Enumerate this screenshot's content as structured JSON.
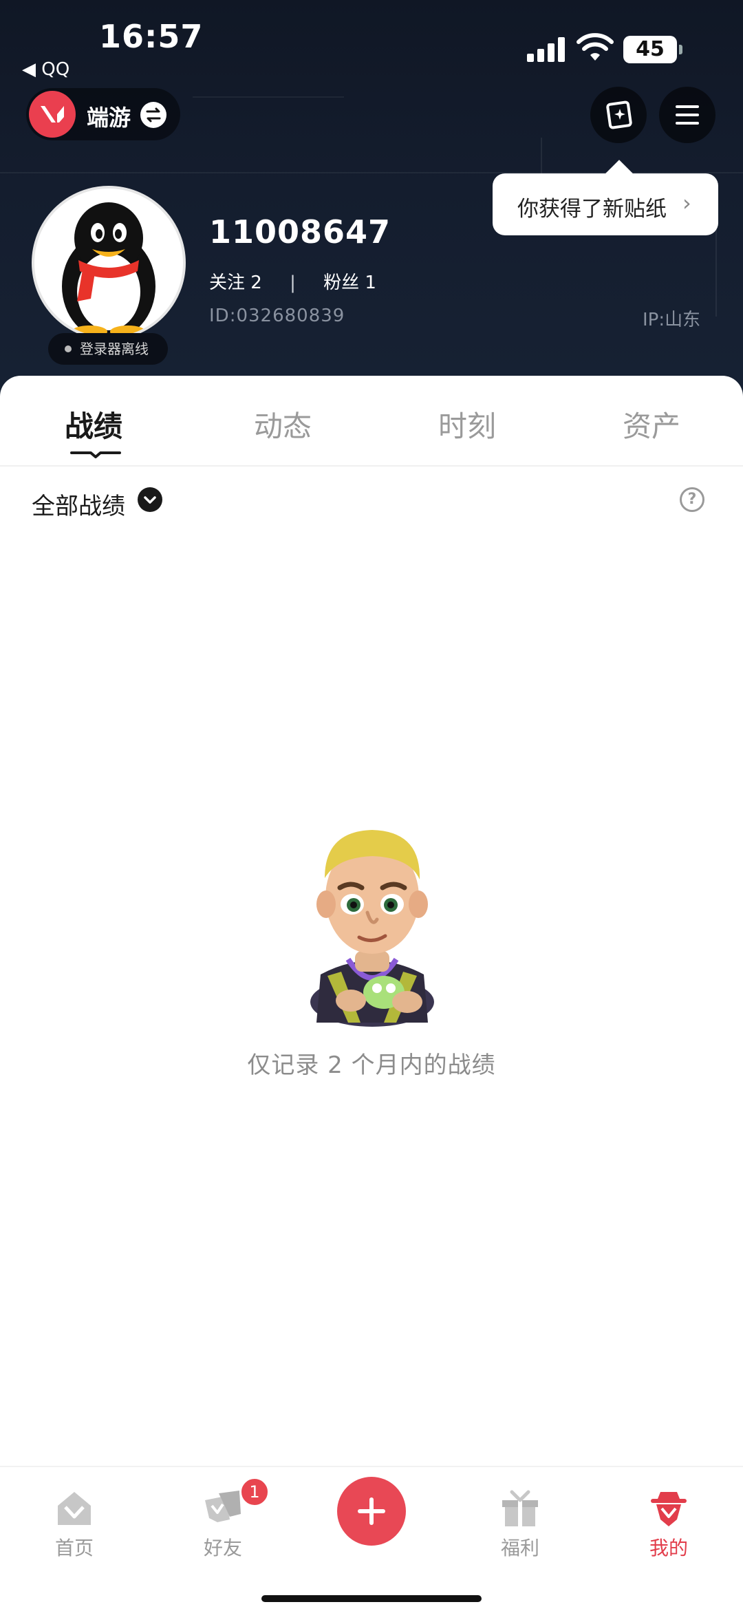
{
  "status_bar": {
    "time": "16:57",
    "back_app": "◀ QQ",
    "battery": "45"
  },
  "header": {
    "game_switch_label": "端游",
    "tooltip_text": "你获得了新贴纸",
    "username": "11008647",
    "follow_label": "关注 2",
    "fans_label": "粉丝 1",
    "divider": "|",
    "id_text": "ID:032680839",
    "ip_text": "IP:山东",
    "offline_text": "登录器离线"
  },
  "tabs": [
    {
      "label": "战绩",
      "active": true
    },
    {
      "label": "动态",
      "active": false
    },
    {
      "label": "时刻",
      "active": false
    },
    {
      "label": "资产",
      "active": false
    }
  ],
  "filter": {
    "label": "全部战绩",
    "help_icon": "?"
  },
  "empty_state": {
    "text": "仅记录 2 个月内的战绩"
  },
  "bottom_nav": [
    {
      "label": "首页",
      "icon": "home-icon"
    },
    {
      "label": "好友",
      "icon": "friends-icon",
      "badge": "1"
    },
    {
      "label": "福利",
      "icon": "gift-icon"
    },
    {
      "label": "我的",
      "icon": "profile-icon",
      "active": true
    }
  ],
  "colors": {
    "accent": "#e84855",
    "header_bg": "#141d2e"
  }
}
